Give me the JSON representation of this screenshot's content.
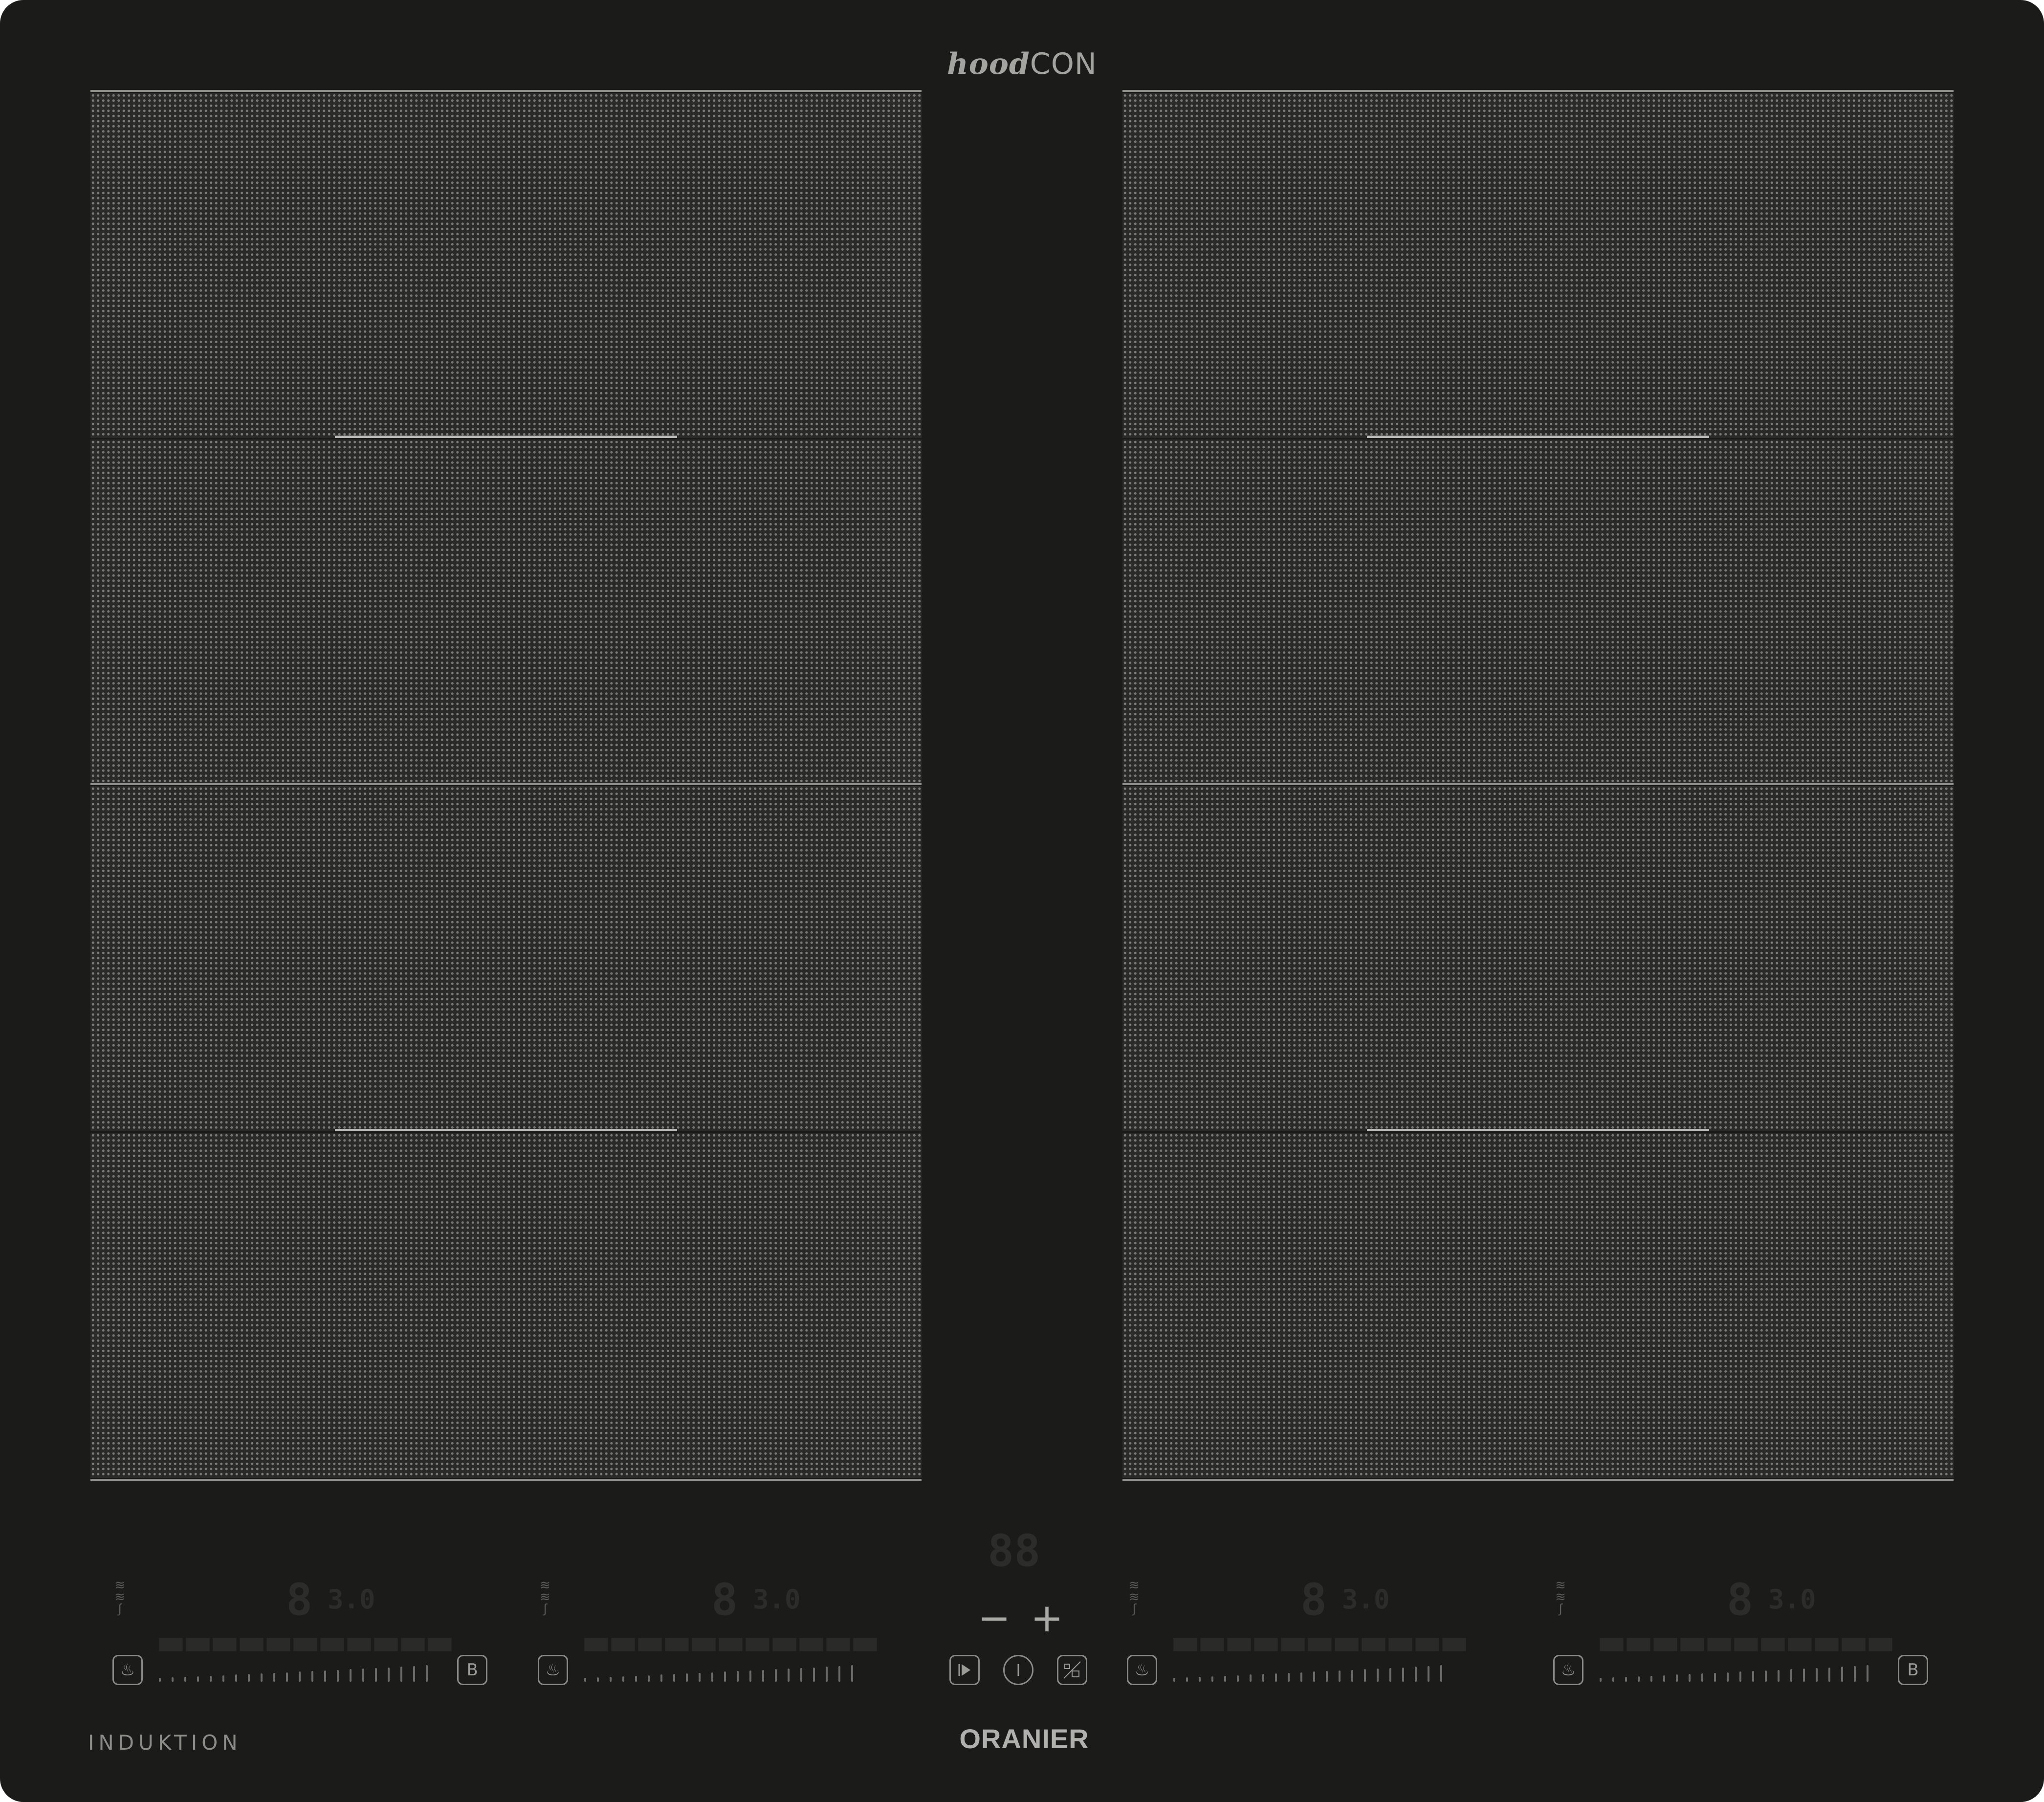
{
  "brand_top": {
    "part1": "hood",
    "part2": "CON"
  },
  "footer": {
    "left_label": "INDUKTION",
    "brand": "ORANIER"
  },
  "controls": [
    {
      "power_digit": "8",
      "timer_digits": "3.0"
    },
    {
      "power_digit": "8",
      "timer_digits": "3.0"
    },
    {
      "power_digit": "8",
      "timer_digits": "3.0"
    },
    {
      "power_digit": "8",
      "timer_digits": "3.0"
    }
  ],
  "center": {
    "display": "88",
    "minus": "−",
    "plus": "+",
    "icons": [
      "play-pause-icon",
      "power-icon",
      "lock-icon"
    ]
  },
  "icons": {
    "heat": "♨",
    "boost": "B"
  }
}
